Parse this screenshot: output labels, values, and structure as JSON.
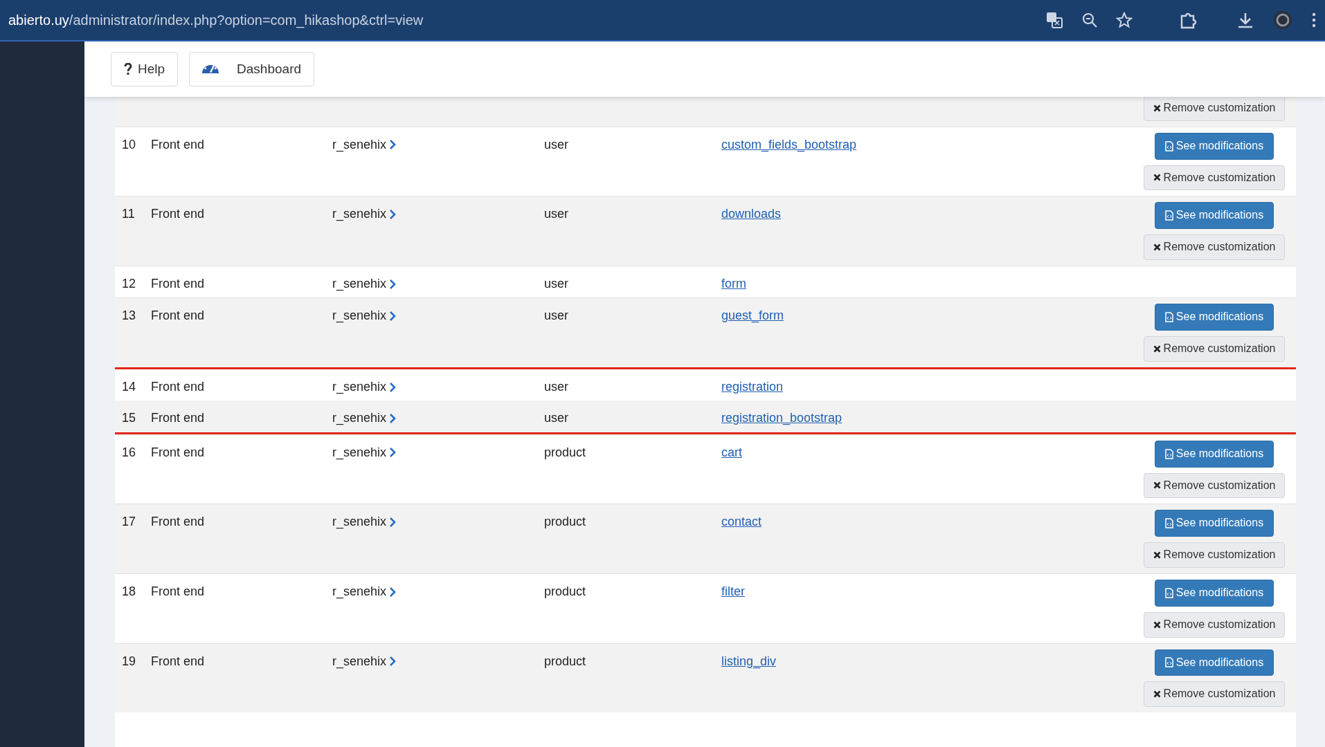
{
  "browser": {
    "url_host": "abierto.uy",
    "url_path": "/administrator/index.php?option=com_hikashop&ctrl=view"
  },
  "toolbar": {
    "buttons": [
      {
        "kind": "help",
        "label": "Help"
      },
      {
        "kind": "dashboard",
        "label": "Dashboard"
      }
    ]
  },
  "table": {
    "rows": [
      {
        "actions": [
          {
            "kind": "remove",
            "label": "Remove customization"
          }
        ]
      },
      {
        "number": "10",
        "client": "Front end",
        "template": "r_senehix",
        "type": "user",
        "file": "custom_fields_bootstrap",
        "highlighted": false,
        "actions": [
          {
            "kind": "see",
            "label": "See modifications"
          },
          {
            "kind": "remove",
            "label": "Remove customization"
          }
        ]
      },
      {
        "number": "11",
        "client": "Front end",
        "template": "r_senehix",
        "type": "user",
        "file": "downloads",
        "highlighted": false,
        "actions": [
          {
            "kind": "see",
            "label": "See modifications"
          },
          {
            "kind": "remove",
            "label": "Remove customization"
          }
        ]
      },
      {
        "number": "12",
        "client": "Front end",
        "template": "r_senehix",
        "type": "user",
        "file": "form",
        "highlighted": false,
        "actions": []
      },
      {
        "number": "13",
        "client": "Front end",
        "template": "r_senehix",
        "type": "user",
        "file": "guest_form",
        "highlighted": false,
        "actions": [
          {
            "kind": "see",
            "label": "See modifications"
          },
          {
            "kind": "remove",
            "label": "Remove customization"
          }
        ]
      },
      {
        "number": "14",
        "client": "Front end",
        "template": "r_senehix",
        "type": "user",
        "file": "registration",
        "highlighted": true,
        "actions": []
      },
      {
        "number": "15",
        "client": "Front end",
        "template": "r_senehix",
        "type": "user",
        "file": "registration_bootstrap",
        "highlighted": true,
        "actions": []
      },
      {
        "number": "16",
        "client": "Front end",
        "template": "r_senehix",
        "type": "product",
        "file": "cart",
        "highlighted": false,
        "actions": [
          {
            "kind": "see",
            "label": "See modifications"
          },
          {
            "kind": "remove",
            "label": "Remove customization"
          }
        ]
      },
      {
        "number": "17",
        "client": "Front end",
        "template": "r_senehix",
        "type": "product",
        "file": "contact",
        "highlighted": false,
        "actions": [
          {
            "kind": "see",
            "label": "See modifications"
          },
          {
            "kind": "remove",
            "label": "Remove customization"
          }
        ]
      },
      {
        "number": "18",
        "client": "Front end",
        "template": "r_senehix",
        "type": "product",
        "file": "filter",
        "highlighted": false,
        "actions": [
          {
            "kind": "see",
            "label": "See modifications"
          },
          {
            "kind": "remove",
            "label": "Remove customization"
          }
        ]
      },
      {
        "number": "19",
        "client": "Front end",
        "template": "r_senehix",
        "type": "product",
        "file": "listing_div",
        "highlighted": false,
        "actions": [
          {
            "kind": "see",
            "label": "See modifications"
          },
          {
            "kind": "remove",
            "label": "Remove customization"
          }
        ]
      }
    ]
  }
}
